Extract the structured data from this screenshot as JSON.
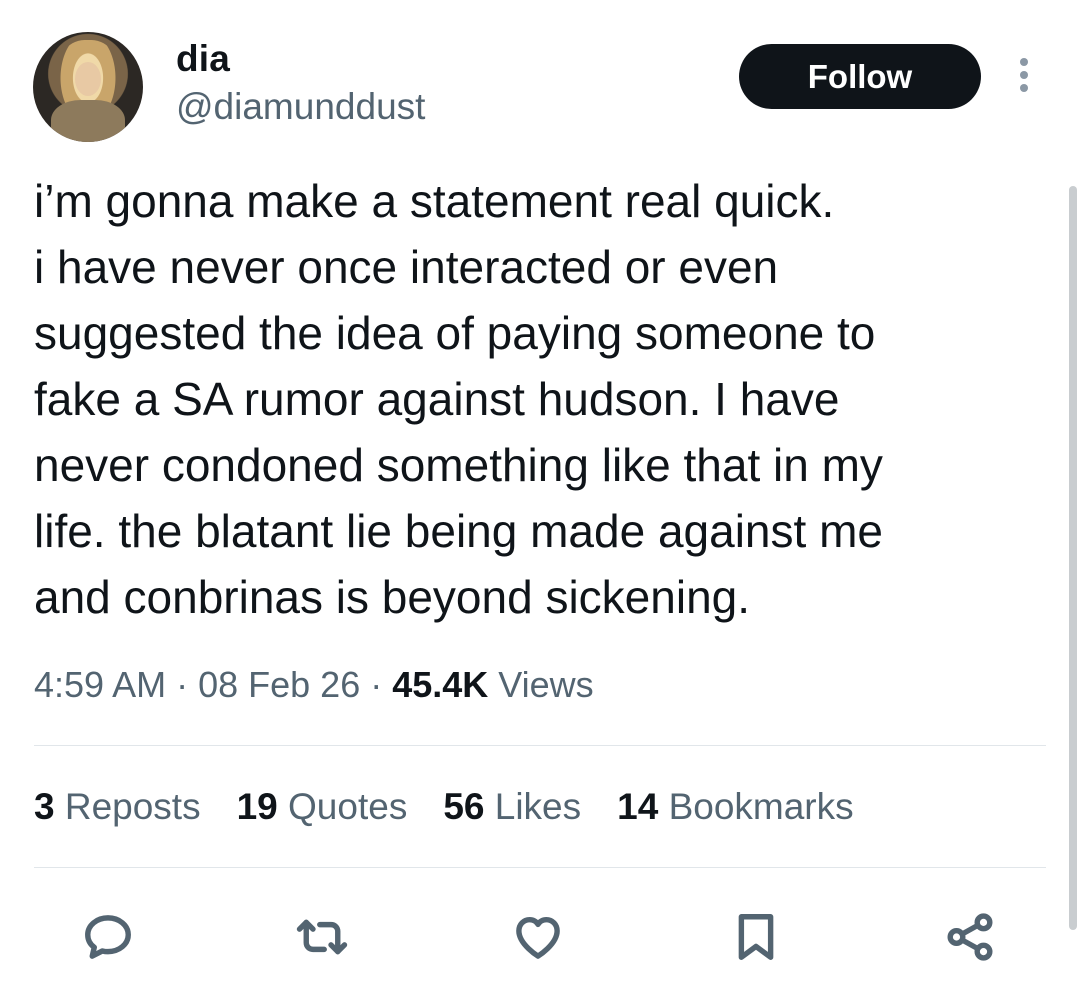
{
  "author": {
    "display_name": "dia",
    "handle": "@diamunddust",
    "avatar_icon": "profile-photo"
  },
  "header": {
    "follow_label": "Follow",
    "more_icon": "more-vertical-icon"
  },
  "tweet": {
    "lines": [
      "i’m gonna make a statement real quick.",
      "i have never once interacted or even",
      "suggested the idea of paying someone to",
      "fake a SA rumor against hudson. I have",
      "never condoned something like that in my",
      "life. the blatant lie being made against me",
      "and conbrinas is beyond sickening."
    ]
  },
  "meta": {
    "time": "4:59 AM",
    "sep1": " · ",
    "date": "08 Feb 26",
    "sep2": " · ",
    "views_count": "45.4K",
    "views_label": " Views"
  },
  "stats": {
    "reposts": {
      "count": "3",
      "label": " Reposts"
    },
    "quotes": {
      "count": "19",
      "label": " Quotes"
    },
    "likes": {
      "count": "56",
      "label": " Likes"
    },
    "bookmarks": {
      "count": "14",
      "label": " Bookmarks"
    }
  },
  "actions": [
    "reply-icon",
    "repost-icon",
    "like-icon",
    "bookmark-icon",
    "share-icon"
  ],
  "colors": {
    "text": "#0f1419",
    "secondary": "#536471",
    "divider": "#e1e6ea",
    "button_bg": "#0f1419"
  }
}
